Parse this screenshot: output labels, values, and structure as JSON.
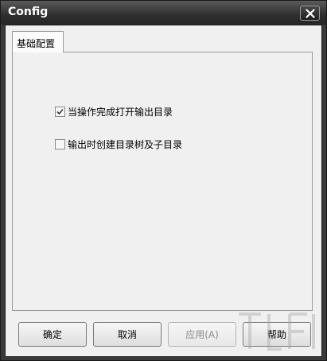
{
  "window": {
    "title": "Config"
  },
  "tabs": [
    {
      "label": "基础配置",
      "selected": true
    }
  ],
  "options": [
    {
      "label": "当操作完成打开输出目录",
      "checked": true
    },
    {
      "label": "输出时创建目录树及子目录",
      "checked": false
    }
  ],
  "buttons": {
    "ok": "确定",
    "cancel": "取消",
    "apply": "应用(A)",
    "help": "帮助"
  },
  "icons": {
    "close": "close-icon",
    "check": "check-icon"
  },
  "colors": {
    "titlebar": "#2e2e2e",
    "client_bg": "#f0f0f0",
    "disabled_text": "#8a8a8a"
  }
}
